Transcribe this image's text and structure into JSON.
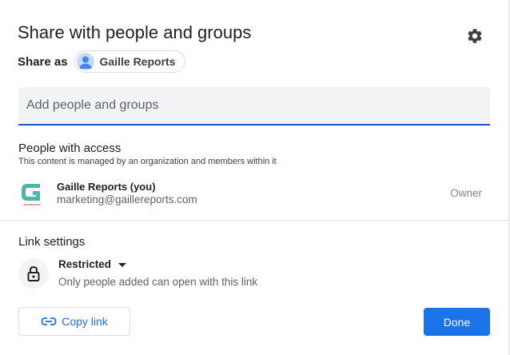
{
  "dialog": {
    "title": "Share with people and groups",
    "settings_icon": "gear-icon"
  },
  "share_as": {
    "label": "Share as",
    "account_name": "Gaille Reports",
    "avatar_icon": "person-avatar-icon"
  },
  "add_people": {
    "placeholder": "Add people and groups",
    "value": ""
  },
  "people_with_access": {
    "title": "People with access",
    "note": "This content is managed by an organization and members within it",
    "people": [
      {
        "name": "Gaille Reports (you)",
        "email": "marketing@gaillereports.com",
        "role": "Owner",
        "avatar_icon": "gaille-reports-logo-icon"
      }
    ]
  },
  "link_settings": {
    "title": "Link settings",
    "access_level": "Restricted",
    "description": "Only people added can open with this link",
    "icon": "lock-icon"
  },
  "footer": {
    "copy_link_label": "Copy link",
    "copy_link_icon": "link-icon",
    "done_label": "Done"
  },
  "colors": {
    "accent": "#1a73e8",
    "input_underline": "#1a56c9",
    "logo_teal": "#4bb9a9"
  }
}
